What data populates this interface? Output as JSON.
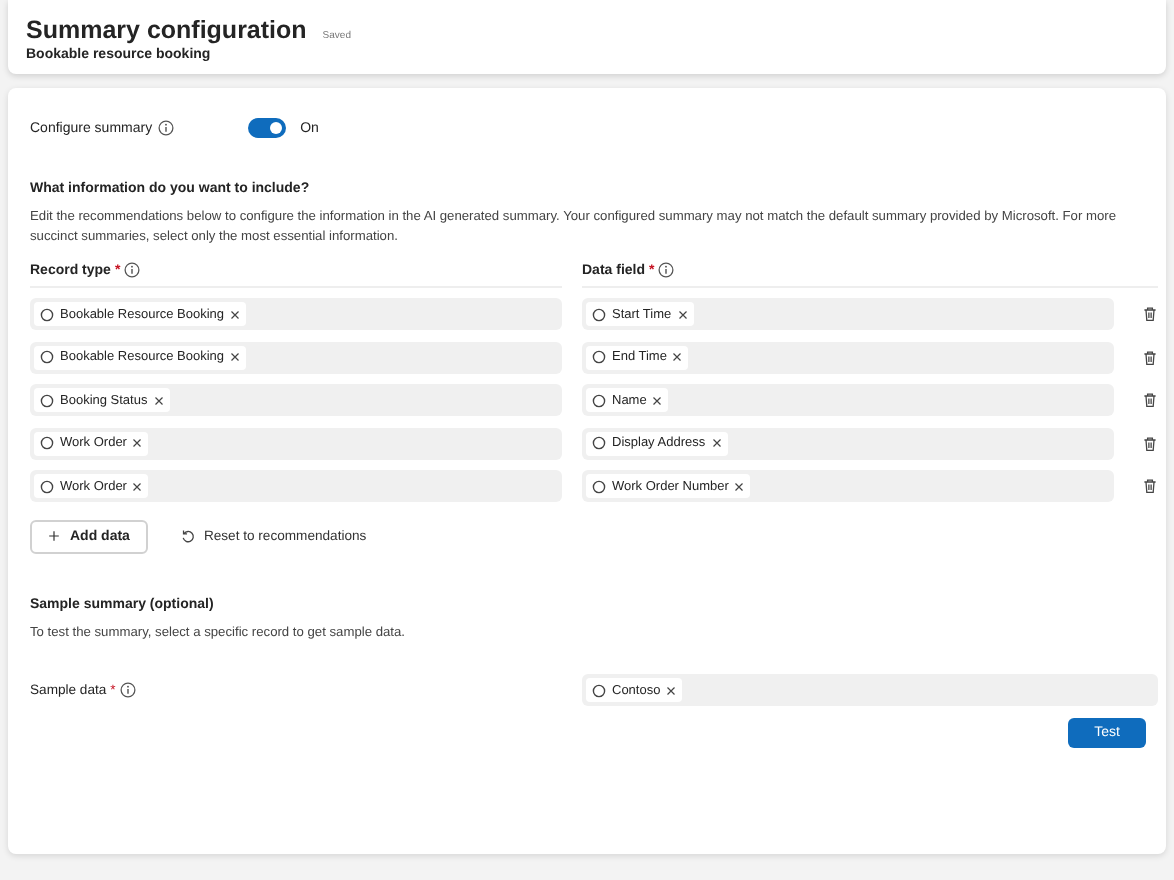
{
  "header": {
    "title": "Summary configuration",
    "status": "Saved",
    "subtitle": "Bookable resource booking"
  },
  "configure": {
    "label": "Configure summary",
    "on": true,
    "state_label": "On"
  },
  "include": {
    "heading": "What information do you want to include?",
    "description": "Edit the recommendations below to configure the information in the AI generated summary. Your configured summary may not match the default summary provided by Microsoft. For more succinct summaries, select only the most essential information."
  },
  "columns": [
    {
      "label": "Record type",
      "required_mark": "*"
    },
    {
      "label": "Data field",
      "required_mark": "*"
    }
  ],
  "rows": [
    {
      "record_type": "Bookable Resource Booking",
      "data_field": "Start Time"
    },
    {
      "record_type": "Bookable Resource Booking",
      "data_field": "End Time"
    },
    {
      "record_type": "Booking Status",
      "data_field": "Name"
    },
    {
      "record_type": "Work Order",
      "data_field": "Display Address"
    },
    {
      "record_type": "Work Order",
      "data_field": "Work Order Number"
    }
  ],
  "actions": {
    "add": "Add data",
    "reset": "Reset to recommendations"
  },
  "sample": {
    "heading": "Sample summary (optional)",
    "description": "To test the summary, select a specific record to get sample data.",
    "label": "Sample data",
    "required_mark": "*",
    "value": "Contoso",
    "button": "Test"
  }
}
